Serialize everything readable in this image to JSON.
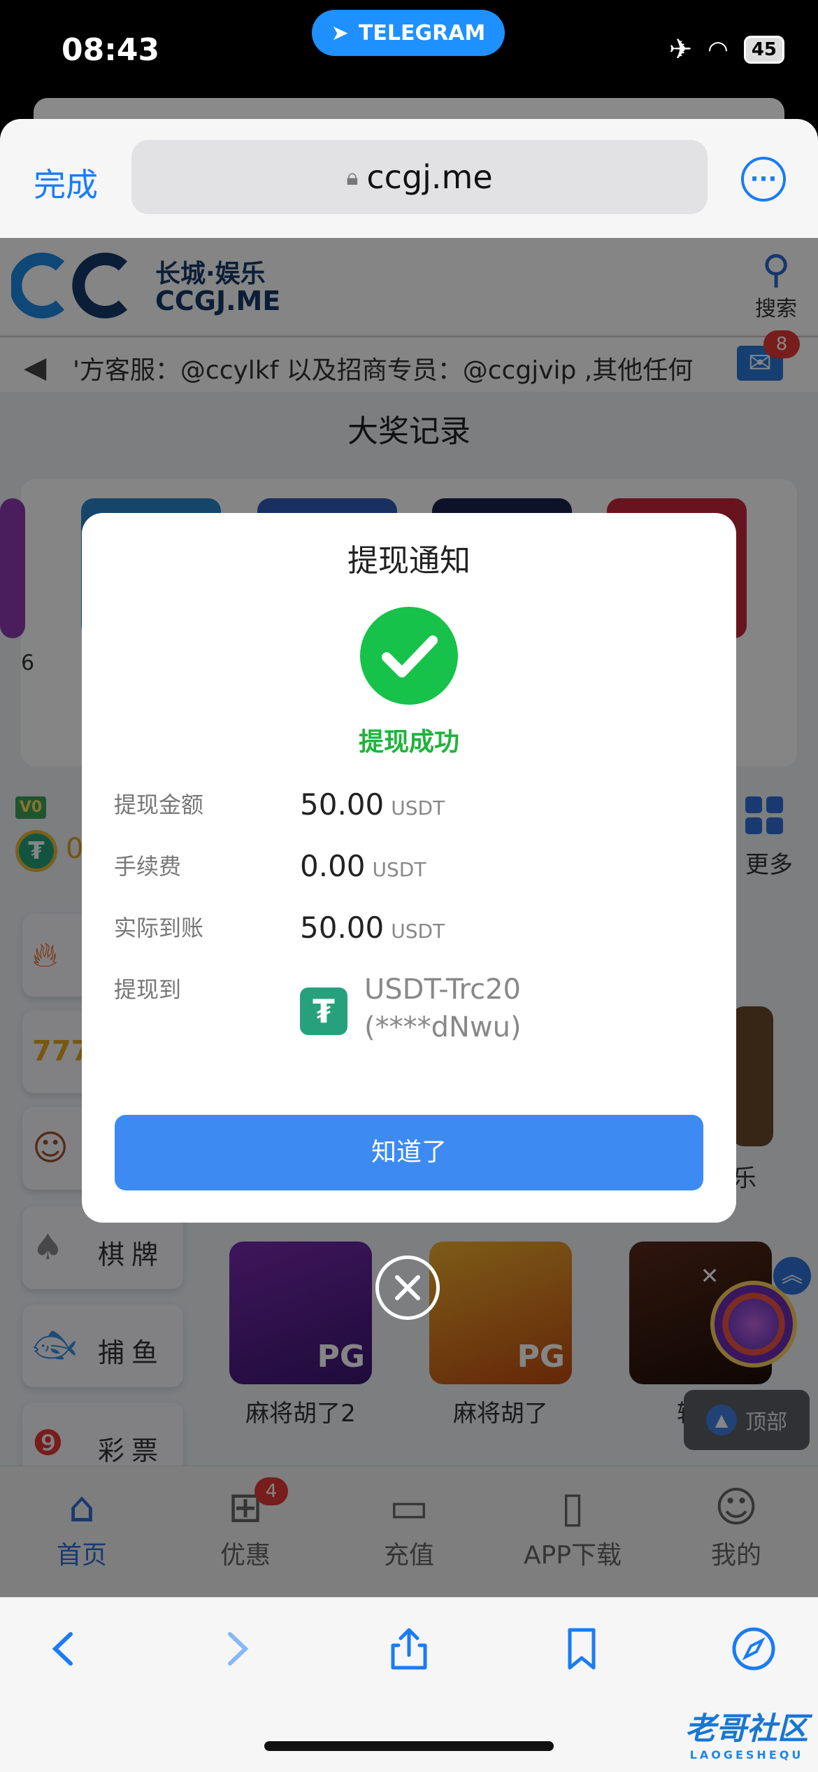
{
  "status_bar": {
    "time": "08:43",
    "telegram_pill": "TELEGRAM",
    "battery": "45"
  },
  "browser": {
    "done_label": "完成",
    "url": "ccgj.me"
  },
  "site": {
    "logo_cn": "长城·娱乐",
    "logo_en": "CCGJ.ME",
    "search_label": "搜索",
    "marquee_text": "'方客服：@ccylkf  以及招商专员：@ccgjvip ,其他任何",
    "mail_badge": "8",
    "section_title": "大奖记录",
    "jackpot_partial_number": "6",
    "vip_tag": "V0",
    "usdt_partial": "0",
    "more_label": "更多",
    "categories": [
      {
        "icon": "flame-icon",
        "label": ""
      },
      {
        "icon": "slot-777-icon",
        "label": ""
      },
      {
        "icon": "live-dealer-icon",
        "label": ""
      },
      {
        "icon": "cards-icon",
        "label": "棋牌"
      },
      {
        "icon": "fish-icon",
        "label": "捕鱼"
      },
      {
        "icon": "lottery-ball-icon",
        "label": "彩票"
      }
    ],
    "partial_right_label": "乐",
    "games": [
      {
        "name": "麻将胡了2",
        "badge": "PG"
      },
      {
        "name": "麻将胡了",
        "badge": "PG"
      },
      {
        "name": "轮盘",
        "badge": ""
      }
    ],
    "top_button": "顶部",
    "tabs": [
      {
        "label": "首页",
        "icon": "home-icon",
        "active": true
      },
      {
        "label": "优惠",
        "icon": "gift-icon",
        "badge": "4"
      },
      {
        "label": "充值",
        "icon": "wallet-icon"
      },
      {
        "label": "APP下载",
        "icon": "phone-icon"
      },
      {
        "label": "我的",
        "icon": "user-icon"
      }
    ]
  },
  "modal": {
    "title": "提现通知",
    "status": "提现成功",
    "rows": [
      {
        "label": "提现金额",
        "value": "50.00",
        "unit": "USDT"
      },
      {
        "label": "手续费",
        "value": "0.00",
        "unit": "USDT"
      },
      {
        "label": "实际到账",
        "value": "50.00",
        "unit": "USDT"
      }
    ],
    "dest_label": "提现到",
    "dest_line1": "USDT-Trc20",
    "dest_line2": "(****dNwu)",
    "button": "知道了"
  },
  "watermark": {
    "cn": "老哥社区",
    "en": "LAOGESHEQU"
  },
  "colors": {
    "accent": "#3d8bf2",
    "success": "#16c24a",
    "tether": "#26a17b",
    "brand": "#163a6a"
  }
}
